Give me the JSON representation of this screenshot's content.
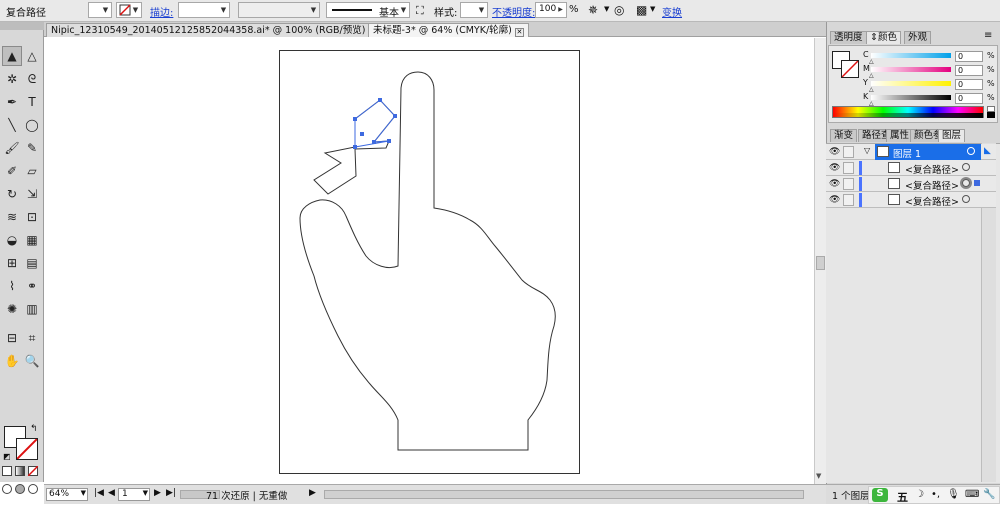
{
  "control_bar": {
    "object_label": "复合路径",
    "stroke_label": "描边:",
    "brush_label": "基本",
    "style_label": "样式:",
    "opacity_label": "不透明度:",
    "opacity_value": "100",
    "percent": "%",
    "transform_label": "变换"
  },
  "tabs": [
    {
      "label": "Nipic_12310549_20140512125852044358.ai* @ 100% (RGB/预览)"
    },
    {
      "label": "未标题-3* @ 64% (CMYK/轮廓)"
    }
  ],
  "tools": [
    {
      "icon": "selection-icon",
      "glyph": "▲"
    },
    {
      "icon": "direct-selection-icon",
      "glyph": "△"
    },
    {
      "icon": "magic-wand-icon",
      "glyph": "✲"
    },
    {
      "icon": "lasso-icon",
      "glyph": "ᘓ"
    },
    {
      "icon": "pen-icon",
      "glyph": "✒"
    },
    {
      "icon": "type-icon",
      "glyph": "T"
    },
    {
      "icon": "line-icon",
      "glyph": "╲"
    },
    {
      "icon": "ellipse-icon",
      "glyph": "◯"
    },
    {
      "icon": "paintbrush-icon",
      "glyph": "🖌"
    },
    {
      "icon": "pencil-icon",
      "glyph": "✎"
    },
    {
      "icon": "blob-brush-icon",
      "glyph": "✐"
    },
    {
      "icon": "eraser-icon",
      "glyph": "▱"
    },
    {
      "icon": "rotate-icon",
      "glyph": "↻"
    },
    {
      "icon": "scale-icon",
      "glyph": "⇲"
    },
    {
      "icon": "warp-icon",
      "glyph": "≋"
    },
    {
      "icon": "free-transform-icon",
      "glyph": "⊡"
    },
    {
      "icon": "shape-builder-icon",
      "glyph": "◒"
    },
    {
      "icon": "perspective-icon",
      "glyph": "▦"
    },
    {
      "icon": "mesh-icon",
      "glyph": "⊞"
    },
    {
      "icon": "gradient-icon",
      "glyph": "▤"
    },
    {
      "icon": "eyedropper-icon",
      "glyph": "⌇"
    },
    {
      "icon": "blend-icon",
      "glyph": "⚭"
    },
    {
      "icon": "symbol-sprayer-icon",
      "glyph": "✺"
    },
    {
      "icon": "column-graph-icon",
      "glyph": "▥"
    },
    {
      "icon": "artboard-icon",
      "glyph": "⊟"
    },
    {
      "icon": "slice-icon",
      "glyph": "⌗"
    },
    {
      "icon": "hand-icon",
      "glyph": "✋"
    },
    {
      "icon": "zoom-icon",
      "glyph": "🔍"
    }
  ],
  "status": {
    "zoom": "64%",
    "artboard": "1",
    "history": "71 次还原 | 无重做"
  },
  "color_panel": {
    "tabs": [
      "透明度",
      "颜色",
      "外观"
    ],
    "channels": [
      {
        "label": "C",
        "value": "0",
        "color": "#00a0e9"
      },
      {
        "label": "M",
        "value": "0",
        "color": "#e4007f"
      },
      {
        "label": "Y",
        "value": "0",
        "color": "#fff100"
      },
      {
        "label": "K",
        "value": "0",
        "color": "#000000"
      }
    ],
    "percent": "%"
  },
  "layers_panel": {
    "tabs": [
      "渐变",
      "路径查",
      "属性",
      "颜色参",
      "图层"
    ],
    "layer_name": "图层 1",
    "items": [
      "<复合路径>",
      "<复合路径>",
      "<复合路径>"
    ],
    "footer": "1 个图层"
  },
  "ime": {
    "mode": "五"
  },
  "colors": {
    "accent_blue": "#1a6ee8",
    "selection_blue": "#3e6ae0"
  }
}
